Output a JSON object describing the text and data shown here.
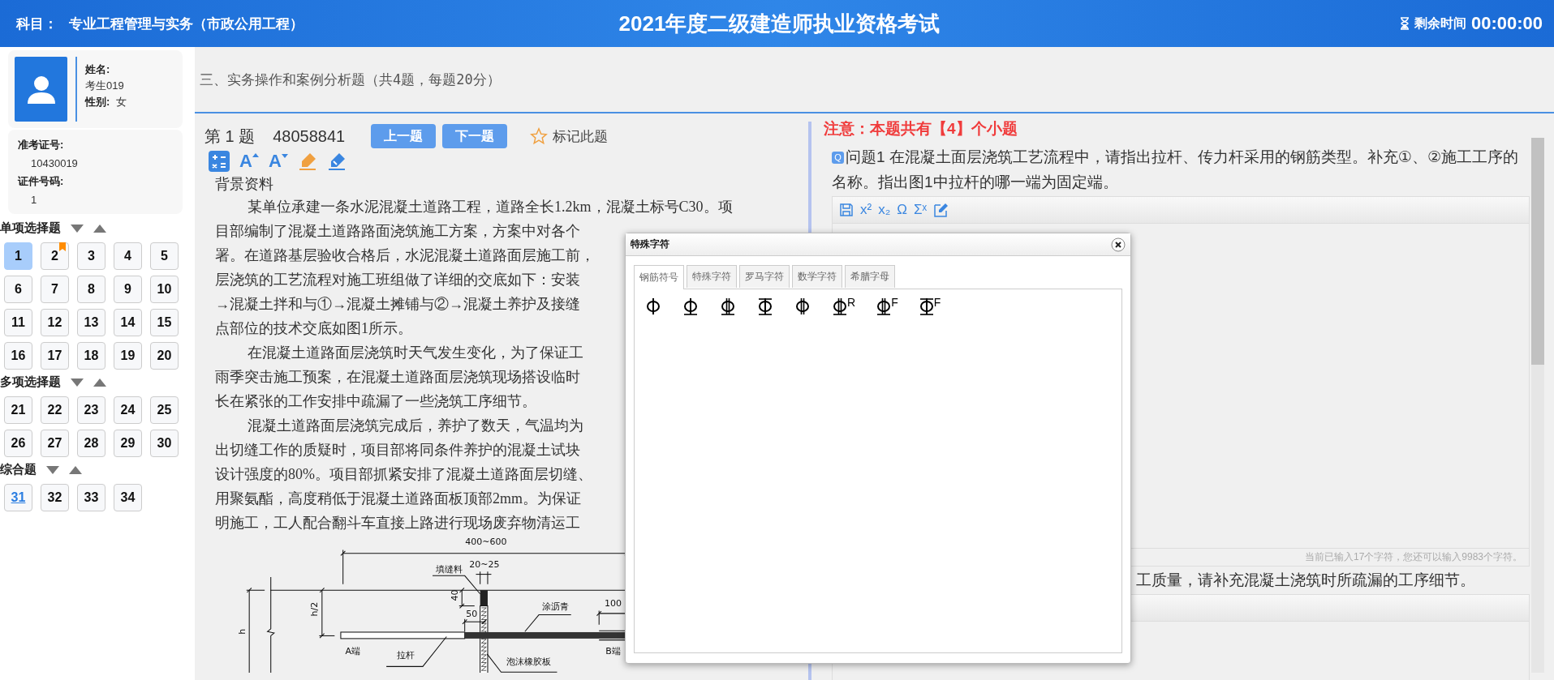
{
  "header": {
    "subject_label": "科目：",
    "subject": "专业工程管理与实务（市政公用工程）",
    "title": "2021年度二级建造师执业资格考试",
    "timer_label": "剩余时间",
    "timer": "00:00:00"
  },
  "candidate": {
    "name_label": "姓名:",
    "name": "考生019",
    "gender_label": "性别:",
    "gender": "女",
    "ticket_label": "准考证号:",
    "ticket": "10430019",
    "id_label": "证件号码:",
    "id": "1"
  },
  "sections": [
    {
      "title": "单项选择题",
      "items": [
        {
          "label": "1",
          "selected": true,
          "flagged": false,
          "current": false
        },
        {
          "label": "2",
          "selected": false,
          "flagged": true,
          "current": false
        },
        {
          "label": "3",
          "selected": false,
          "flagged": false,
          "current": false
        },
        {
          "label": "4",
          "selected": false,
          "flagged": false,
          "current": false
        },
        {
          "label": "5",
          "selected": false,
          "flagged": false,
          "current": false
        },
        {
          "label": "6",
          "selected": false,
          "flagged": false,
          "current": false
        },
        {
          "label": "7",
          "selected": false,
          "flagged": false,
          "current": false
        },
        {
          "label": "8",
          "selected": false,
          "flagged": false,
          "current": false
        },
        {
          "label": "9",
          "selected": false,
          "flagged": false,
          "current": false
        },
        {
          "label": "10",
          "selected": false,
          "flagged": false,
          "current": false
        },
        {
          "label": "11",
          "selected": false,
          "flagged": false,
          "current": false
        },
        {
          "label": "12",
          "selected": false,
          "flagged": false,
          "current": false
        },
        {
          "label": "13",
          "selected": false,
          "flagged": false,
          "current": false
        },
        {
          "label": "14",
          "selected": false,
          "flagged": false,
          "current": false
        },
        {
          "label": "15",
          "selected": false,
          "flagged": false,
          "current": false
        },
        {
          "label": "16",
          "selected": false,
          "flagged": false,
          "current": false
        },
        {
          "label": "17",
          "selected": false,
          "flagged": false,
          "current": false
        },
        {
          "label": "18",
          "selected": false,
          "flagged": false,
          "current": false
        },
        {
          "label": "19",
          "selected": false,
          "flagged": false,
          "current": false
        },
        {
          "label": "20",
          "selected": false,
          "flagged": false,
          "current": false
        }
      ]
    },
    {
      "title": "多项选择题",
      "items": [
        {
          "label": "21",
          "selected": false,
          "flagged": false,
          "current": false
        },
        {
          "label": "22",
          "selected": false,
          "flagged": false,
          "current": false
        },
        {
          "label": "23",
          "selected": false,
          "flagged": false,
          "current": false
        },
        {
          "label": "24",
          "selected": false,
          "flagged": false,
          "current": false
        },
        {
          "label": "25",
          "selected": false,
          "flagged": false,
          "current": false
        },
        {
          "label": "26",
          "selected": false,
          "flagged": false,
          "current": false
        },
        {
          "label": "27",
          "selected": false,
          "flagged": false,
          "current": false
        },
        {
          "label": "28",
          "selected": false,
          "flagged": false,
          "current": false
        },
        {
          "label": "29",
          "selected": false,
          "flagged": false,
          "current": false
        },
        {
          "label": "30",
          "selected": false,
          "flagged": false,
          "current": false
        }
      ]
    },
    {
      "title": "综合题",
      "items": [
        {
          "label": "31",
          "selected": false,
          "flagged": false,
          "current": true
        },
        {
          "label": "32",
          "selected": false,
          "flagged": false,
          "current": false
        },
        {
          "label": "33",
          "selected": false,
          "flagged": false,
          "current": false
        },
        {
          "label": "34",
          "selected": false,
          "flagged": false,
          "current": false
        }
      ]
    }
  ],
  "section_bar": "三、实务操作和案例分析题（共4题，每题20分）",
  "question": {
    "number": "第 1 题",
    "code": "48058841",
    "prev": "上一题",
    "next": "下一题",
    "mark": "标记此题",
    "tools": [
      {
        "kind": "calculator"
      },
      {
        "kind": "font-up",
        "label": "A"
      },
      {
        "kind": "font-down",
        "label": "A"
      },
      {
        "kind": "highlighter"
      },
      {
        "kind": "pen"
      }
    ],
    "background_title": "背景资料",
    "paragraphs": [
      [
        "某单位承建一条水泥混凝土道路工程，道路全长1.2km，混凝土标号C30。项",
        "目部编制了混凝土道路路面浇筑施工方案，方案中对各个",
        "署。在道路基层验收合格后，水泥混凝土道路面层施工前，",
        "层浇筑的工艺流程对施工班组做了详细的交底如下：安装",
        "→混凝土拌和与①→混凝土摊铺与②→混凝土养护及接缝",
        "点部位的技术交底如图1所示。"
      ],
      [
        "在混凝土道路面层浇筑时天气发生变化，为了保证工",
        "雨季突击施工预案，在混凝土道路面层浇筑现场搭设临时",
        "长在紧张的工作安排中疏漏了一些浇筑工序细节。"
      ],
      [
        "混凝土道路面层浇筑完成后，养护了数天，气温均为",
        "出切缝工作的质疑时，项目部将同条件养护的混凝土试块",
        "设计强度的80%。项目部抓紧安排了混凝土道路面层切缝、",
        "用聚氨酯，高度稍低于混凝土道路面板顶部2mm。为保证",
        "明施工，工人配合翻斗车直接上路进行现场废弃物清运工"
      ]
    ],
    "figure": {
      "labels": [
        "400~600",
        "20~25",
        "填缝料",
        "40",
        "h/2",
        "h",
        "50",
        "涂沥青",
        "100",
        "A端",
        "拉杆",
        "B端",
        "泡沫橡胶板"
      ]
    }
  },
  "answer": {
    "notice": "注意：本题共有【4】个小题",
    "badge": "Q",
    "q1": "问题1  在混凝土面层浇筑工艺流程中，请指出拉杆、传力杆采用的钢筋类型。补充①、②施工工序的名称。指出图1中拉杆的哪一端为固定端。",
    "tools": [
      {
        "kind": "save"
      },
      {
        "kind": "text",
        "label": "x²"
      },
      {
        "kind": "text",
        "label": "x₂"
      },
      {
        "kind": "text",
        "label": "Ω"
      },
      {
        "kind": "text",
        "label": "Σˣ"
      },
      {
        "kind": "edit"
      }
    ],
    "counter": "当前已输入17个字符，您还可以输入9983个字符。",
    "q2": "工质量，请补充混凝土浇筑时所疏漏的工序细节。"
  },
  "dialog": {
    "title": "特殊字符",
    "tabs": [
      {
        "label": "钢筋符号",
        "selected": true
      },
      {
        "label": "特殊字符",
        "selected": false
      },
      {
        "label": "罗马字符",
        "selected": false
      },
      {
        "label": "数学字符",
        "selected": false
      },
      {
        "label": "希腊字母",
        "selected": false
      }
    ],
    "symbols": [
      {
        "kind": "plain"
      },
      {
        "kind": "base"
      },
      {
        "kind": "double-base"
      },
      {
        "kind": "top-base"
      },
      {
        "kind": "double"
      },
      {
        "kind": "double-base",
        "sup": "R"
      },
      {
        "kind": "double-base",
        "sup": "F"
      },
      {
        "kind": "top-base",
        "sup": "F"
      }
    ]
  }
}
